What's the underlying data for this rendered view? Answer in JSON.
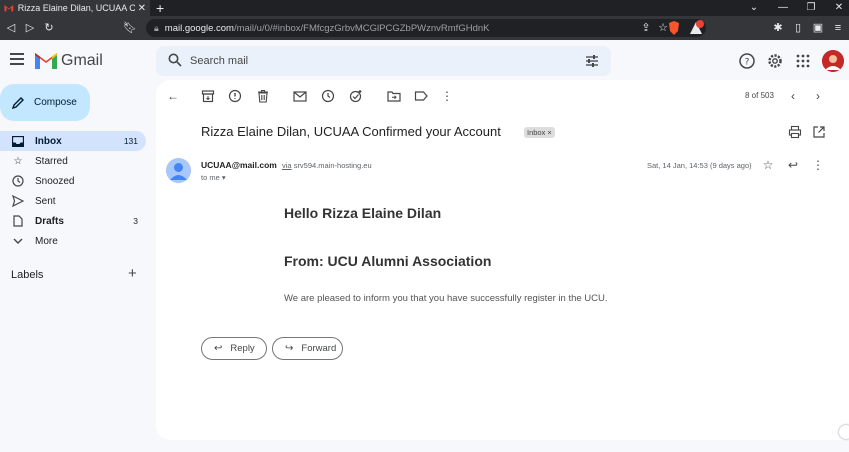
{
  "browser": {
    "tab_title": "Rizza Elaine Dilan, UCUAA Confir",
    "new_tab": "+",
    "url_host": "mail.google.com",
    "url_path": "/mail/u/0/#inbox/FMfcgzGrbvMCGlPCGZbPWznvRmfGHdnK"
  },
  "gmail": {
    "brand": "Gmail",
    "search_placeholder": "Search mail",
    "compose_label": "Compose",
    "nav": [
      {
        "label": "Inbox",
        "count": "131"
      },
      {
        "label": "Starred",
        "count": ""
      },
      {
        "label": "Snoozed",
        "count": ""
      },
      {
        "label": "Sent",
        "count": ""
      },
      {
        "label": "Drafts",
        "count": "3"
      },
      {
        "label": "More",
        "count": ""
      }
    ],
    "labels_heading": "Labels",
    "labels_add": "+"
  },
  "message": {
    "pagination": "8 of 503",
    "subject": "Rizza Elaine Dilan, UCUAA Confirmed your Account",
    "badge": "Inbox ×",
    "sender": "UCUAA@mail.com",
    "via_prefix": "via",
    "via_host": "srv594.main-hosting.eu",
    "to": "to me",
    "date": "Sat, 14 Jan, 14:53 (9 days ago)",
    "body_heading1": "Hello Rizza Elaine Dilan",
    "body_heading2": "From: UCU Alumni Association",
    "body_text": "We are pleased to inform you that you have successfully register in the UCU.",
    "reply_label": "Reply",
    "forward_label": "Forward"
  },
  "colors": {
    "accent": "#c2e7ff",
    "active_nav": "#d3e3fd",
    "search_bg": "#eaf1fb",
    "page_bg": "#f6f8fc"
  }
}
